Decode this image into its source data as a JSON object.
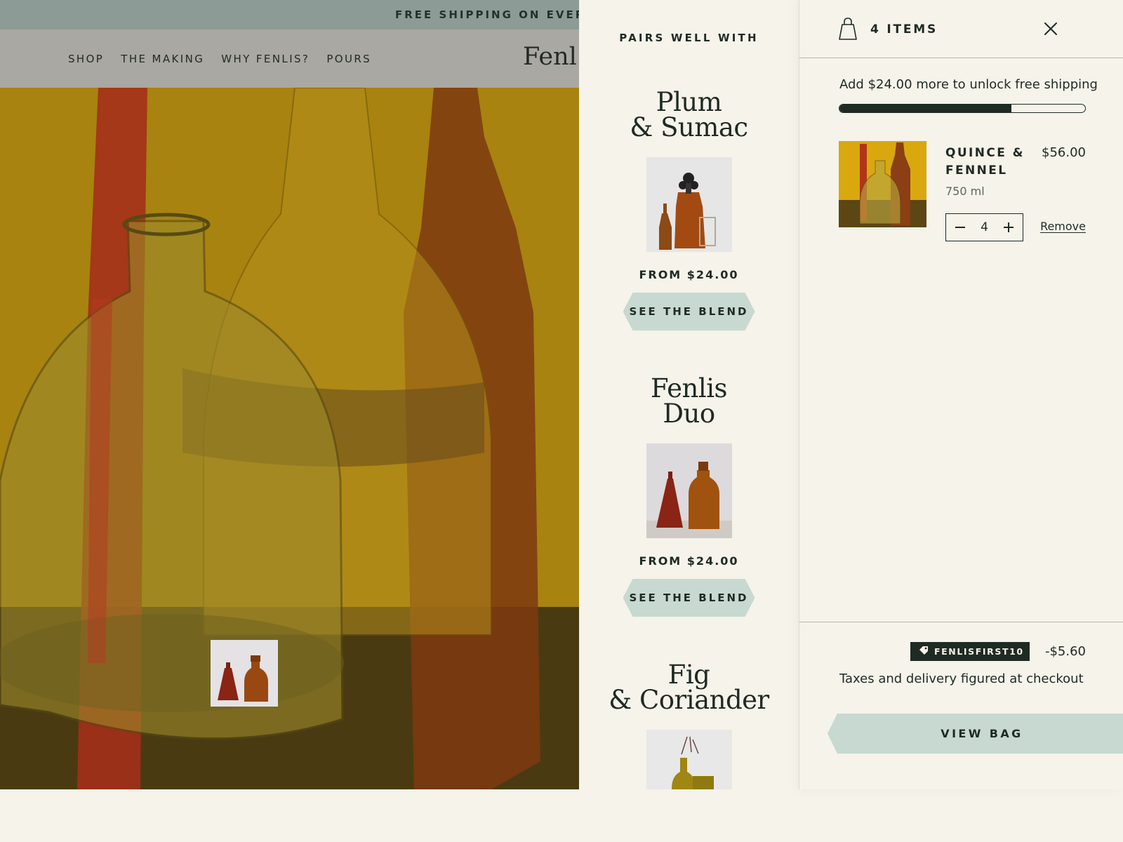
{
  "announcement": "FREE SHIPPING ON EVERY O",
  "nav": {
    "items": [
      "SHOP",
      "THE MAKING",
      "WHY FENLIS?",
      "POURS"
    ],
    "logo": "Fenl"
  },
  "pairs": {
    "title": "PAIRS WELL WITH",
    "items": [
      {
        "name_line1": "Plum",
        "name_line2": "& Sumac",
        "price": "FROM $24.00",
        "button": "SEE THE BLEND"
      },
      {
        "name_line1": "Fenlis",
        "name_line2": "Duo",
        "price": "FROM $24.00",
        "button": "SEE THE BLEND"
      },
      {
        "name_line1": "Fig",
        "name_line2": "& Coriander"
      }
    ]
  },
  "cart": {
    "items_count": "4 ITEMS",
    "shipping_message": "Add $24.00 more to unlock free shipping",
    "shipping_progress": 0.7,
    "line_item": {
      "title": "QUINCE & FENNEL",
      "price": "$56.00",
      "variant": "750 ml",
      "quantity": "4",
      "remove_label": "Remove"
    },
    "discount": {
      "code": "FENLISFIRST10",
      "amount": "-$5.60"
    },
    "tax_note": "Taxes and delivery figured at checkout",
    "view_bag_label": "VIEW BAG"
  },
  "icons": {
    "bag": "shopping-bag-icon",
    "close": "close-icon",
    "minus": "minus-icon",
    "plus": "plus-icon",
    "tag": "tag-icon"
  },
  "colors": {
    "background": "#f5f3ea",
    "ink": "#1f2a24",
    "accent": "#c7d9d0",
    "announcement_bar": "#8c9b95"
  }
}
